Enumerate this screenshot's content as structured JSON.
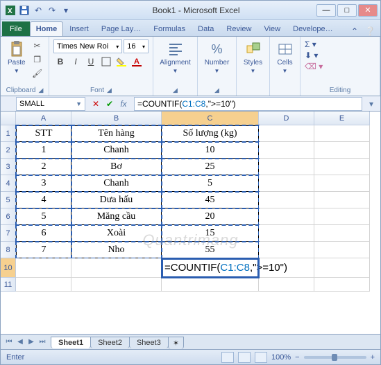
{
  "window": {
    "title": "Book1 - Microsoft Excel",
    "min": "—",
    "max": "□",
    "close": "✕"
  },
  "qat": {
    "undo": "↶",
    "redo": "↷"
  },
  "tabs": {
    "file": "File",
    "home": "Home",
    "insert": "Insert",
    "page": "Page Lay…",
    "formulas": "Formulas",
    "data": "Data",
    "review": "Review",
    "view": "View",
    "developer": "Develope…"
  },
  "ribbon": {
    "clipboard": {
      "label": "Clipboard",
      "paste": "Paste"
    },
    "font": {
      "label": "Font",
      "name": "Times New Roi",
      "size": "16",
      "bold": "B",
      "italic": "I",
      "underline": "U"
    },
    "alignment": {
      "label": "Alignment"
    },
    "number": {
      "label": "Number"
    },
    "styles": {
      "label": "Styles"
    },
    "cells": {
      "label": "Cells"
    },
    "editing": {
      "label": "Editing"
    }
  },
  "namebox": "SMALL",
  "formula_bar": "=COUNTIF(C1:C8,\">=10\")",
  "formula_parts": {
    "fn": "=COUNTIF(",
    "ref": "C1:C8",
    "rest": ",\">=10\")"
  },
  "cols": {
    "A": "A",
    "B": "B",
    "C": "C",
    "D": "D",
    "E": "E"
  },
  "rows": [
    "1",
    "2",
    "3",
    "4",
    "5",
    "6",
    "7",
    "8",
    "10"
  ],
  "table": {
    "header": {
      "A": "STT",
      "B": "Tên hàng",
      "C": "Số lượng (kg)"
    },
    "data": [
      {
        "A": "1",
        "B": "Chanh",
        "C": "10"
      },
      {
        "A": "2",
        "B": "Bơ",
        "C": "25"
      },
      {
        "A": "3",
        "B": "Chanh",
        "C": "5"
      },
      {
        "A": "4",
        "B": "Dưa hấu",
        "C": "45"
      },
      {
        "A": "5",
        "B": "Măng cầu",
        "C": "20"
      },
      {
        "A": "6",
        "B": "Xoài",
        "C": "15"
      },
      {
        "A": "7",
        "B": "Nho",
        "C": "55"
      }
    ]
  },
  "chart_data": {
    "type": "table",
    "title": "Số lượng (kg) theo Tên hàng",
    "columns": [
      "STT",
      "Tên hàng",
      "Số lượng (kg)"
    ],
    "rows": [
      [
        1,
        "Chanh",
        10
      ],
      [
        2,
        "Bơ",
        25
      ],
      [
        3,
        "Chanh",
        5
      ],
      [
        4,
        "Dưa hấu",
        45
      ],
      [
        5,
        "Măng cầu",
        20
      ],
      [
        6,
        "Xoài",
        15
      ],
      [
        7,
        "Nho",
        55
      ]
    ]
  },
  "cell_formula": {
    "fn": "=COUNTIF(",
    "ref": "C1:C8",
    "rest": ",\">=10\")"
  },
  "sheets": {
    "s1": "Sheet1",
    "s2": "Sheet2",
    "s3": "Sheet3"
  },
  "status": {
    "mode": "Enter",
    "zoom": "100%",
    "minus": "−",
    "plus": "+"
  },
  "watermark": "Quantrimang"
}
